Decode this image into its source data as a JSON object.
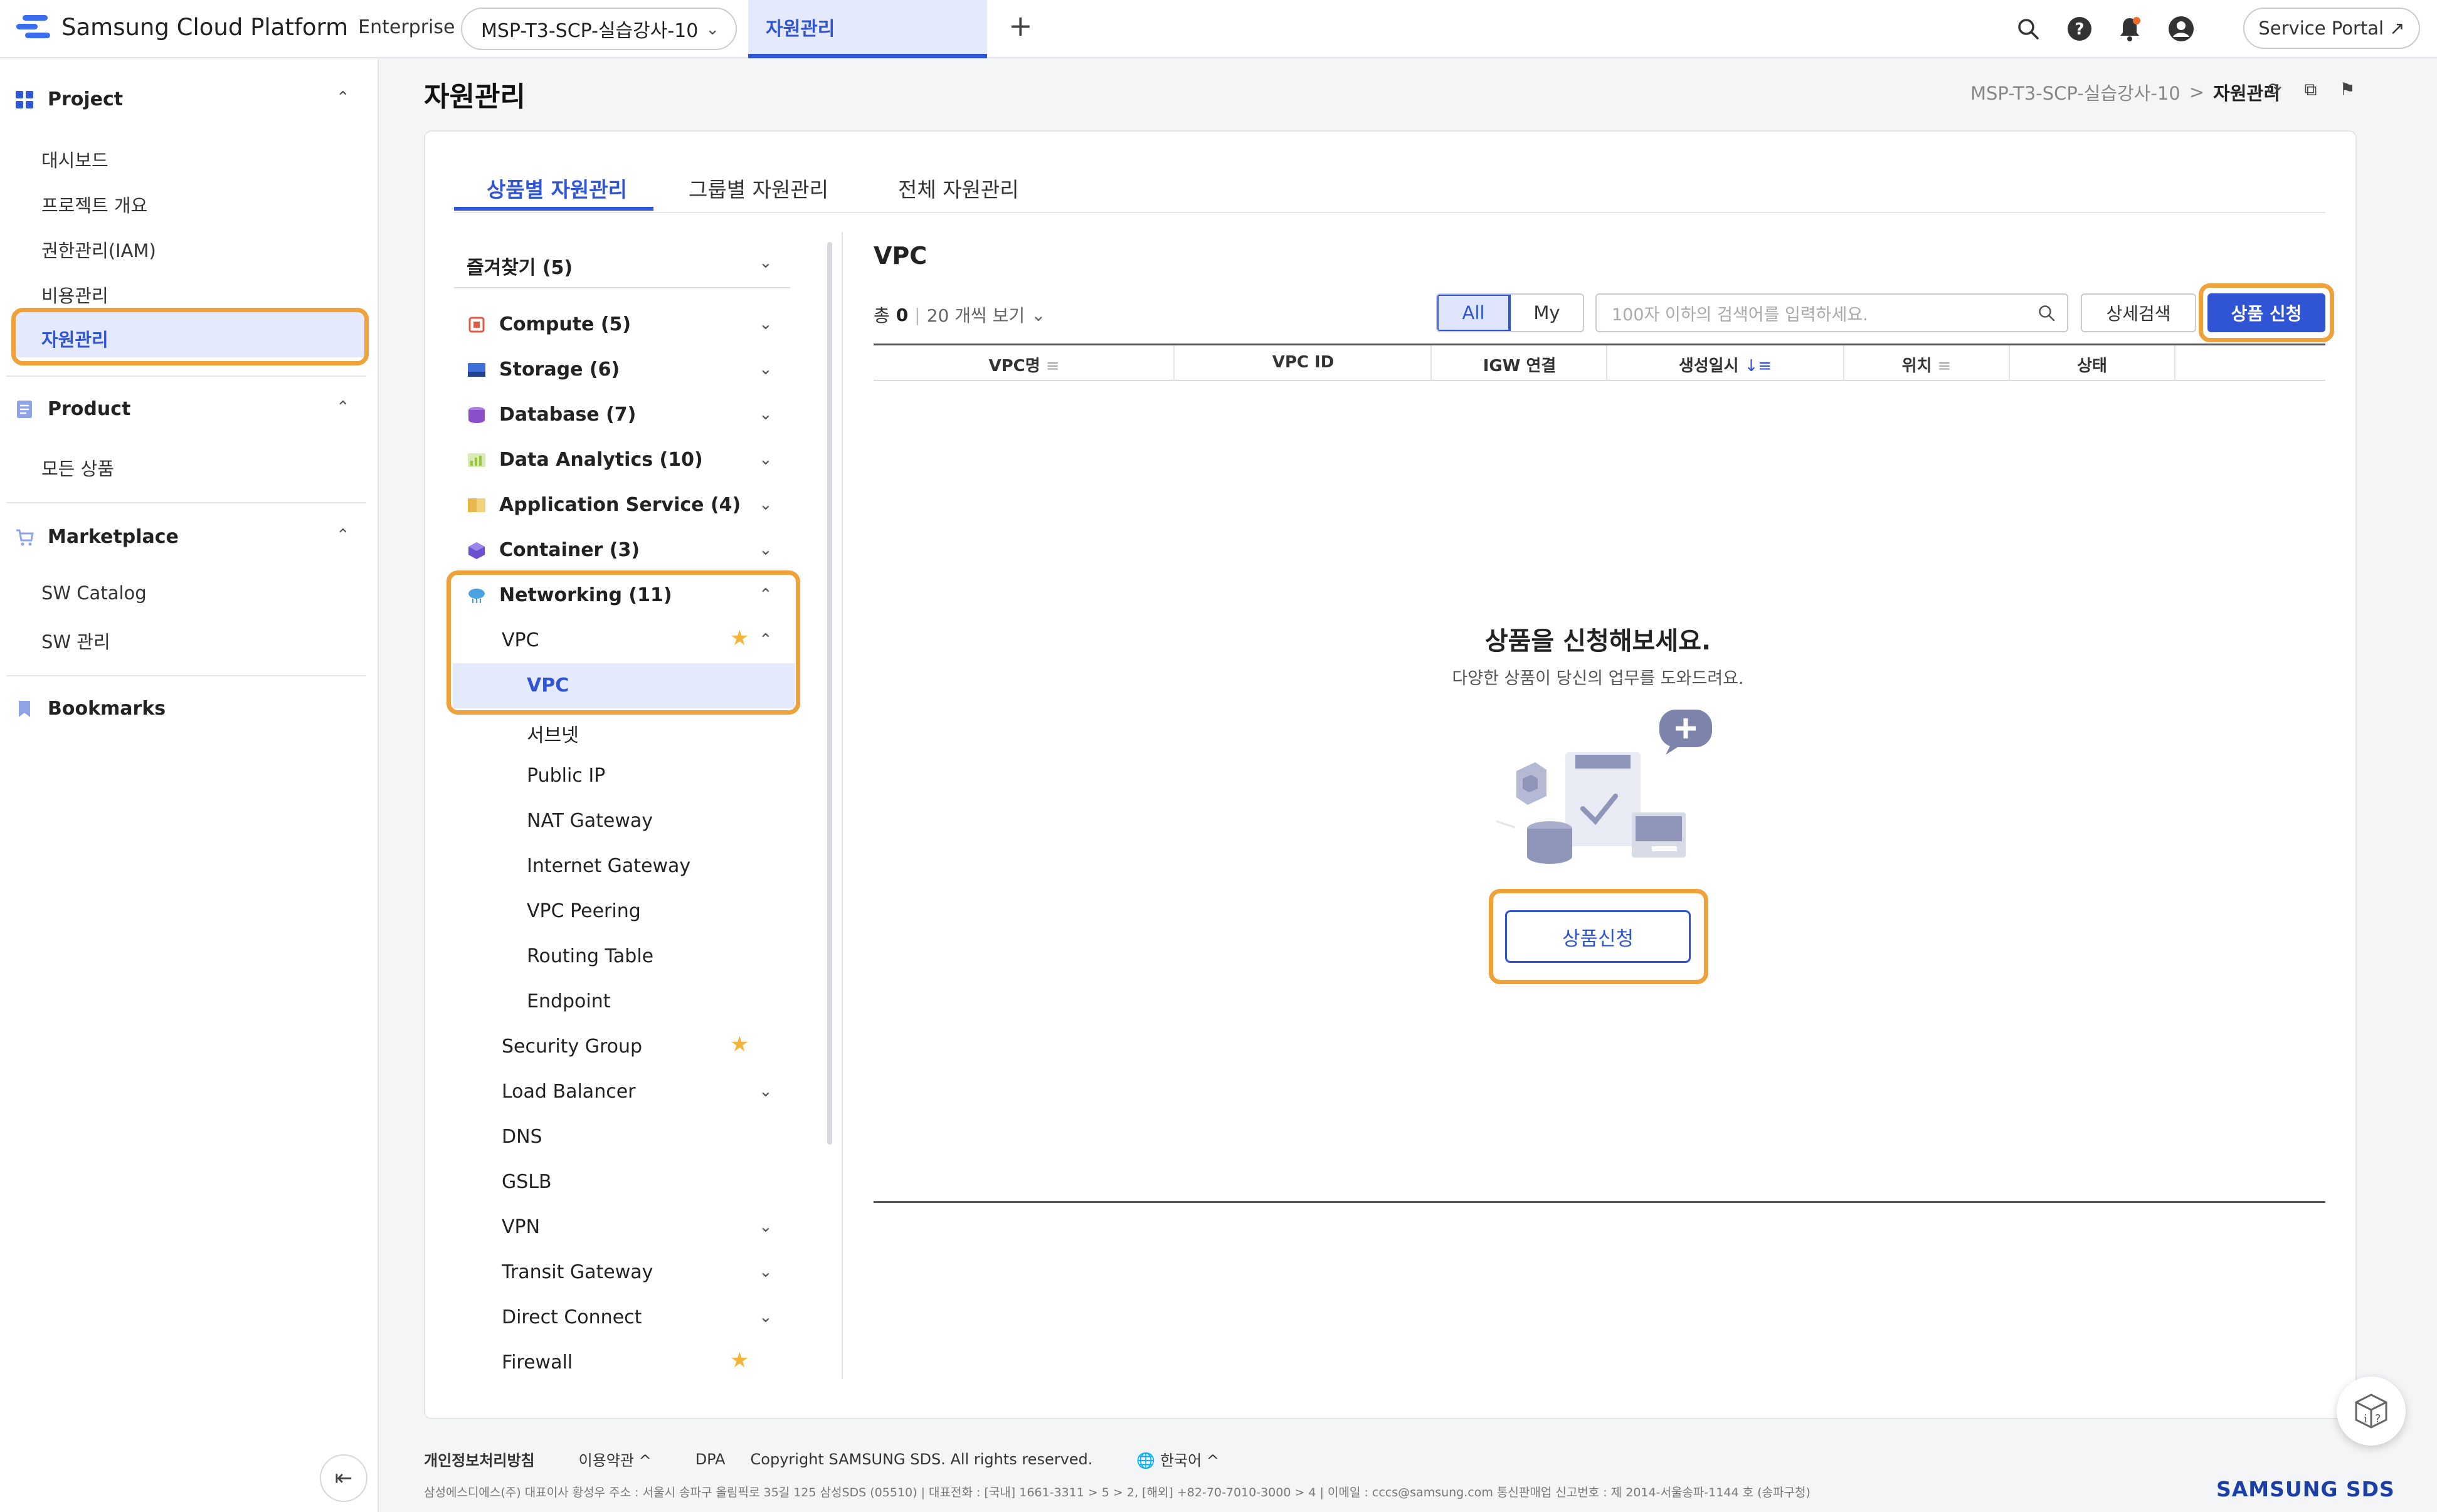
{
  "app": {
    "logo_text": "Samsung Cloud Platform",
    "logo_sub": "Enterprise",
    "project_select": "MSP-T3-SCP-실습강사-10",
    "active_tab": "자원관리",
    "service_portal": "Service Portal ↗"
  },
  "sidebar": {
    "project_label": "Project",
    "project_items": [
      "대시보드",
      "프로젝트 개요",
      "권한관리(IAM)",
      "비용관리",
      "자원관리"
    ],
    "product_label": "Product",
    "product_items": [
      "모든 상품"
    ],
    "marketplace_label": "Marketplace",
    "marketplace_items": [
      "SW Catalog",
      "SW 관리"
    ],
    "bookmarks_label": "Bookmarks"
  },
  "page": {
    "title": "자원관리",
    "breadcrumb_parent": "MSP-T3-SCP-실습강사-10",
    "breadcrumb_sep": ">",
    "breadcrumb_current": "자원관리"
  },
  "tabs": [
    "상품별 자원관리",
    "그룹별 자원관리",
    "전체 자원관리"
  ],
  "tree": {
    "favorites": "즐겨찾기 (5)",
    "categories": [
      {
        "label": "Compute (5)",
        "color": "#e05a47"
      },
      {
        "label": "Storage (6)",
        "color": "#3e6fd8"
      },
      {
        "label": "Database (7)",
        "color": "#8b4fc9"
      },
      {
        "label": "Data Analytics (10)",
        "color": "#9bc53d"
      },
      {
        "label": "Application Service (4)",
        "color": "#e8b84a"
      },
      {
        "label": "Container (3)",
        "color": "#6b4fd1"
      },
      {
        "label": "Networking (11)",
        "color": "#4aa3e0"
      }
    ],
    "networking": {
      "vpc_group": "VPC",
      "vpc_children": [
        "VPC",
        "서브넷",
        "Public IP",
        "NAT Gateway",
        "Internet Gateway",
        "VPC Peering",
        "Routing Table",
        "Endpoint"
      ],
      "others": [
        "Security Group",
        "Load Balancer",
        "DNS",
        "GSLB",
        "VPN",
        "Transit Gateway",
        "Direct Connect",
        "Firewall"
      ]
    }
  },
  "panel": {
    "title": "VPC",
    "total_label": "총",
    "total_value": "0",
    "per_page": "20 개씩 보기",
    "seg_all": "All",
    "seg_my": "My",
    "search_placeholder": "100자 이하의 검색어를 입력하세요.",
    "detail_search": "상세검색",
    "apply": "상품 신청",
    "columns": [
      "VPC명",
      "VPC ID",
      "IGW 연결",
      "생성일시",
      "위치",
      "상태"
    ],
    "empty_title": "상품을 신청해보세요.",
    "empty_sub": "다양한 상품이 당신의 업무를 도와드려요.",
    "empty_button": "상품신청"
  },
  "footer": {
    "privacy": "개인정보처리방침",
    "terms": "이용약관 ^",
    "dpa": "DPA",
    "copyright": "Copyright SAMSUNG SDS. All rights reserved.",
    "language": "한국어 ^",
    "address": "삼성에스디에스(주) 대표이사 황성우 주소 : 서울시 송파구 올림픽로 35길 125 삼성SDS (05510) | 대표전화 : [국내] 1661-3311 > 5 > 2, [해외] +82-70-7010-3000 > 4 | 이메일 : cccs@samsung.com 통신판매업 신고번호 : 제 2014-서울송파-1144 호 (송파구청)",
    "brand": "SAMSUNG SDS"
  },
  "colors": {
    "accent": "#2f55d4",
    "highlight": "#f0a23a",
    "selected_bg": "#e4e9fb"
  }
}
